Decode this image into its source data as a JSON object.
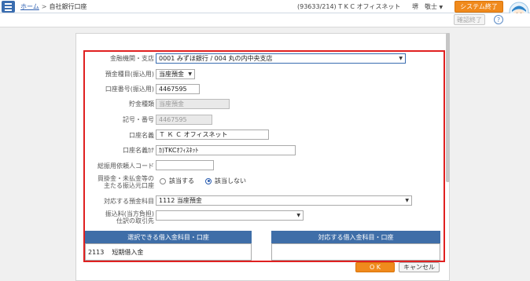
{
  "header": {
    "breadcrumb_home": "ホーム",
    "breadcrumb_sep": ">",
    "breadcrumb_current": "自社銀行口座",
    "account": "(93633/214) T K C オフィスネット",
    "user": "堺　敬士",
    "system_exit": "システム終了"
  },
  "toolbar": {
    "confirm_exit": "確認終了",
    "help": "?"
  },
  "form": {
    "bank_label": "金融機関・支店",
    "bank_value": "0001 みずほ銀行 / 004 丸の内中央支店",
    "deposit_type_label": "預金種目(振込用)",
    "deposit_type_value": "当座預金",
    "account_no_label": "口座番号(振込用)",
    "account_no_value": "4467595",
    "savings_type_label": "貯金種類",
    "savings_type_value": "当座預金",
    "symbol_no_label": "記号・番号",
    "symbol_no_value": "4467595",
    "account_name_label": "口座名義",
    "account_name_value": "Ｔ Ｋ Ｃ オフィスネット",
    "account_name_kana_label": "口座名義ｶﾅ",
    "account_name_kana_value": "ｶ)TKCｵﾌｨｽﾈｯﾄ",
    "client_code_label": "総振用依頼人コード",
    "client_code_value": "",
    "main_account_label_1": "買掛金・未払金等の",
    "main_account_label_2": "主たる振込元口座",
    "radio_yes": "該当する",
    "radio_no": "該当しない",
    "deposit_subject_label": "対応する預金科目",
    "deposit_subject_value": "1112 当座預金",
    "fee_label_1": "振込料(当方負担)",
    "fee_label_2": "仕訳の取引先",
    "fee_value": ""
  },
  "tables": {
    "left_header": "選択できる借入金科目・口座",
    "right_header": "対応する借入金科目・口座",
    "left_rows": [
      {
        "code": "2113",
        "name": "短期借入金"
      }
    ]
  },
  "buttons": {
    "ok": "O K",
    "cancel": "キャンセル"
  },
  "colors": {
    "accent_orange": "#f08a1c",
    "header_blue": "#3f6ea8",
    "highlight_red": "#e02020"
  }
}
